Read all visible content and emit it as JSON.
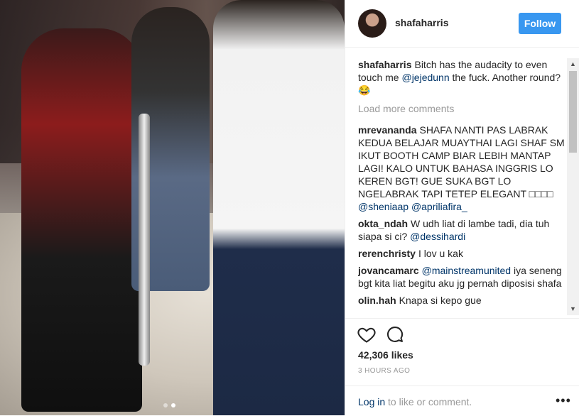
{
  "post": {
    "author": "shafaharris",
    "follow_label": "Follow",
    "caption_user": "shafaharris",
    "caption_parts": [
      "Bitch has the audacity to even touch me ",
      "@jejedunn",
      " the fuck. Another round?😂"
    ],
    "load_more": "Load more comments",
    "likes": "42,306 likes",
    "time": "3 HOURS AGO",
    "login_link": "Log in",
    "login_rest": " to like or comment.",
    "more": "•••"
  },
  "comments": [
    {
      "user": "mrevananda",
      "parts": [
        "SHAFA NANTI PAS LABRAK KEDUA BELAJAR MUAYTHAI LAGI SHAF SM IKUT BOOTH CAMP BIAR LEBIH MANTAP LAGI! KALO UNTUK BAHASA INGGRIS LO KEREN BGT! GUE SUKA BGT LO NGELABRAK TAPI TETEP ELEGANT □□□□ "
      ],
      "mentions": [
        "@sheniaap",
        "@apriliafira_"
      ]
    },
    {
      "user": "okta_ndah",
      "parts": [
        "W udh liat di lambe tadi, dia tuh siapa si ci? "
      ],
      "mentions": [
        "@dessihardi"
      ]
    },
    {
      "user": "rerenchristy",
      "parts": [
        "I lov u kak"
      ],
      "mentions": []
    },
    {
      "user": "jovancamarc",
      "pre_mention": "@mainstreamunited",
      "parts": [
        " iya seneng bgt kita liat begitu aku jg pernah diposisi shafa"
      ],
      "mentions": []
    },
    {
      "user": "olin.hah",
      "parts": [
        "Knapa si kepo gue"
      ],
      "mentions": []
    }
  ],
  "icons": {
    "like": "heart-icon",
    "comment": "comment-bubble-icon",
    "scroll_up": "triangle-up",
    "scroll_down": "triangle-down"
  },
  "colors": {
    "follow_bg": "#3897f0",
    "mention": "#003569",
    "muted": "#999999"
  },
  "carousel": {
    "count": 2,
    "active": 2
  }
}
